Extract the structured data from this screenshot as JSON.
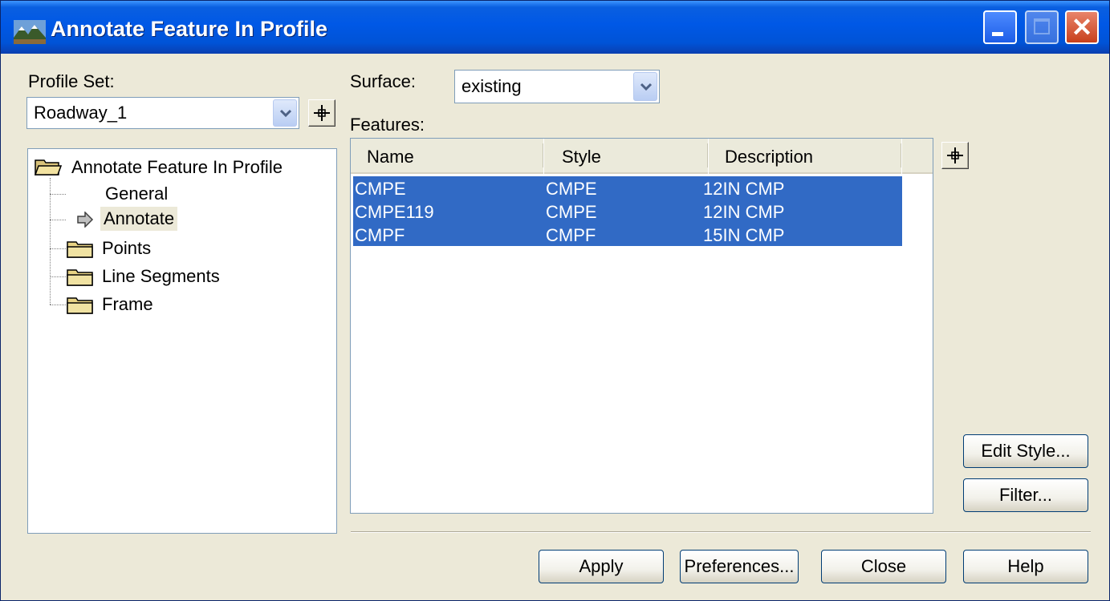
{
  "window": {
    "title": "Annotate Feature In Profile",
    "controls": [
      "minimize-icon",
      "maximize-icon",
      "close-icon"
    ]
  },
  "profile_set": {
    "label": "Profile Set:",
    "value": "Roadway_1"
  },
  "surface": {
    "label": "Surface:",
    "value": "existing"
  },
  "features": {
    "label": "Features:",
    "columns": [
      "Name",
      "Style",
      "Description"
    ],
    "rows": [
      {
        "name": "CMPE",
        "style": "CMPE",
        "description": "12IN CMP",
        "selected": true
      },
      {
        "name": "CMPE119",
        "style": "CMPE",
        "description": "12IN CMP",
        "selected": true
      },
      {
        "name": "CMPF",
        "style": "CMPF",
        "description": "15IN CMP",
        "selected": true
      }
    ]
  },
  "tree": {
    "root": "Annotate Feature In Profile",
    "items": [
      "General",
      "Annotate",
      "Points",
      "Line Segments",
      "Frame"
    ],
    "selected": "Annotate"
  },
  "side_buttons": {
    "edit_style": "Edit Style...",
    "filter": "Filter..."
  },
  "footer_buttons": {
    "apply": "Apply",
    "preferences": "Preferences...",
    "close": "Close",
    "help": "Help"
  },
  "colors": {
    "titlebar": "#0058e6",
    "selection": "#316ac5",
    "dialog_bg": "#ece9d8"
  }
}
